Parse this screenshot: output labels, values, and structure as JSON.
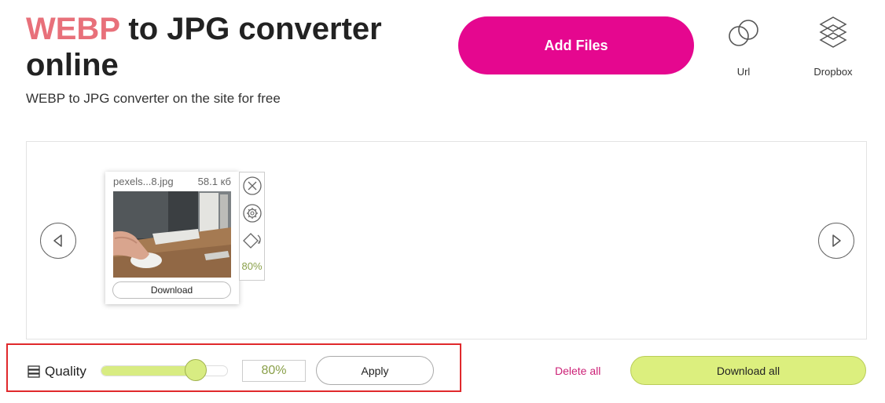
{
  "header": {
    "title_accent": "WEBP",
    "title_rest": " to JPG converter online",
    "subtitle": "WEBP to JPG converter on the site for free"
  },
  "actions": {
    "add_files_label": "Add Files",
    "url_label": "Url",
    "dropbox_label": "Dropbox"
  },
  "file_card": {
    "filename": "pexels...8.jpg",
    "size": "58.1 кб",
    "download_label": "Download",
    "quality": "80%"
  },
  "quality": {
    "label": "Quality",
    "value": 80,
    "value_text": "80%",
    "apply_label": "Apply"
  },
  "footer": {
    "delete_all_label": "Delete all",
    "download_all_label": "Download all"
  },
  "colors": {
    "accent_pink": "#e5078f",
    "title_accent": "#e8707a",
    "lime": "#d8ec82",
    "highlight_red": "#e0292c"
  }
}
